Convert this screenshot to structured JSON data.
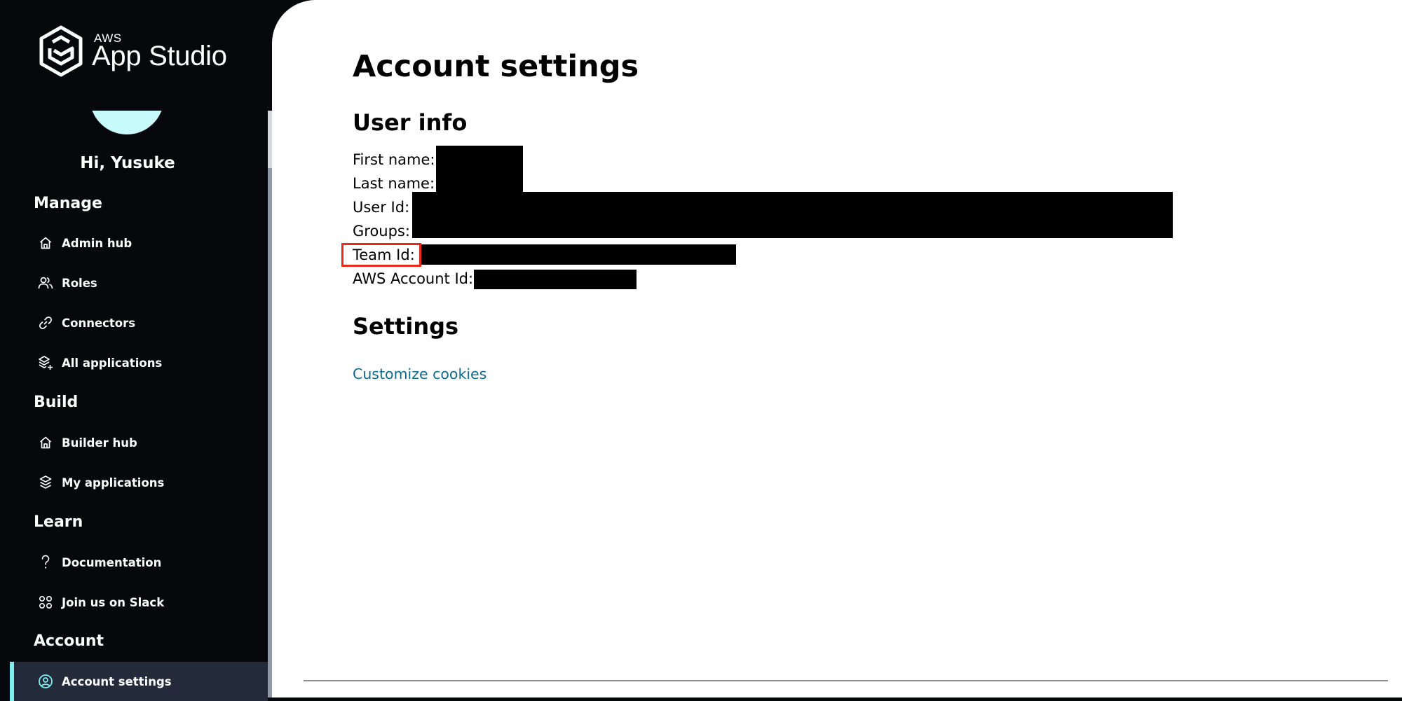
{
  "brand": {
    "prefix": "AWS",
    "name": "App Studio",
    "logo_icon": "app-studio-hex-logo"
  },
  "user": {
    "greeting": "Hi, Yusuke",
    "avatar_color": "#c8fbfb"
  },
  "sidebar": {
    "sections": [
      {
        "heading": "Manage",
        "items": [
          {
            "label": "Admin hub",
            "icon": "home-icon"
          },
          {
            "label": "Roles",
            "icon": "users-icon"
          },
          {
            "label": "Connectors",
            "icon": "link-icon"
          },
          {
            "label": "All applications",
            "icon": "layers-plus-icon"
          }
        ]
      },
      {
        "heading": "Build",
        "items": [
          {
            "label": "Builder hub",
            "icon": "home-icon"
          },
          {
            "label": "My applications",
            "icon": "layers-icon"
          }
        ]
      },
      {
        "heading": "Learn",
        "items": [
          {
            "label": "Documentation",
            "icon": "question-icon"
          },
          {
            "label": "Join us on Slack",
            "icon": "slack-grid-icon"
          }
        ]
      },
      {
        "heading": "Account",
        "items": [
          {
            "label": "Account settings",
            "icon": "user-circle-icon",
            "active": true
          }
        ]
      }
    ],
    "active_accent": "#7defef"
  },
  "main": {
    "title": "Account settings",
    "user_info": {
      "heading": "User info",
      "fields": [
        {
          "label": "First name:",
          "value": "[redacted]"
        },
        {
          "label": "Last name:",
          "value": "[redacted]"
        },
        {
          "label": "User Id:",
          "value": "[redacted]"
        },
        {
          "label": "Groups:",
          "value": "[redacted]"
        },
        {
          "label": "Team Id:",
          "value": "[redacted]",
          "highlighted": true
        },
        {
          "label": "AWS Account Id:",
          "value": "[redacted]"
        }
      ]
    },
    "settings": {
      "heading": "Settings",
      "link_label": "Customize cookies",
      "link_color": "#0f6b8f"
    },
    "highlight_color": "#e8291c"
  }
}
